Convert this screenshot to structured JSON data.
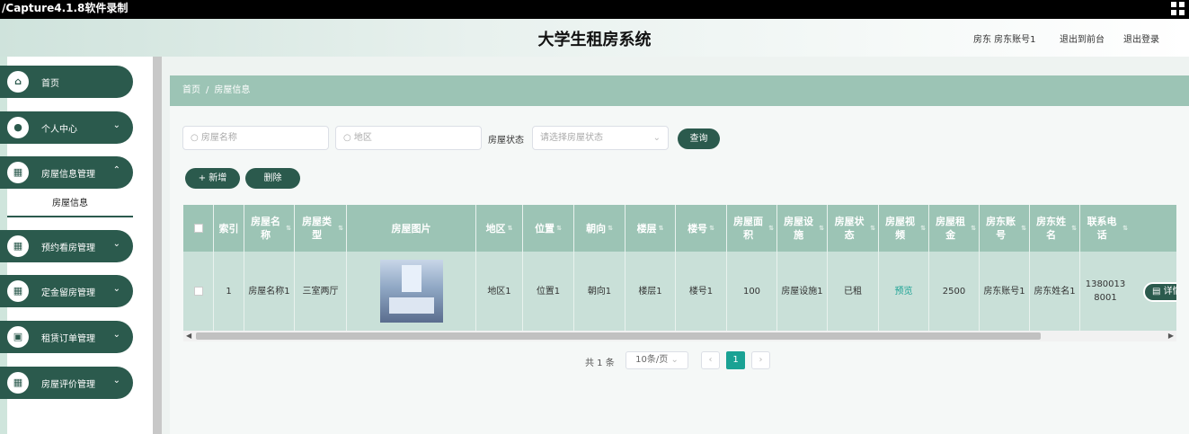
{
  "capture": {
    "title": "/Capture4.1.8软件录制"
  },
  "header": {
    "title": "大学生租房系统",
    "user_text": "房东 房东账号1",
    "back_home": "退出到前台",
    "logout": "退出登录"
  },
  "sidebar": {
    "items": [
      {
        "label": "首页",
        "icon": "home-icon"
      },
      {
        "label": "个人中心",
        "icon": "user-icon"
      },
      {
        "label": "房屋信息管理",
        "icon": "grid-icon"
      },
      {
        "label": "预约看房管理",
        "icon": "grid-icon"
      },
      {
        "label": "定金留房管理",
        "icon": "grid-icon"
      },
      {
        "label": "租赁订单管理",
        "icon": "image-icon"
      },
      {
        "label": "房屋评价管理",
        "icon": "grid-icon"
      }
    ],
    "submenu_label": "房屋信息"
  },
  "breadcrumb": {
    "home": "首页",
    "sep": "/",
    "current": "房屋信息"
  },
  "search": {
    "house_name_placeholder": "房屋名称",
    "area_placeholder": "地区",
    "status_label": "房屋状态",
    "status_placeholder": "请选择房屋状态",
    "query_button": "查询"
  },
  "actions": {
    "add": "+ 新增",
    "delete": "删除"
  },
  "table": {
    "headers": [
      "索引",
      "房屋名称",
      "房屋类型",
      "房屋图片",
      "地区",
      "位置",
      "朝向",
      "楼层",
      "楼号",
      "房屋面积",
      "房屋设施",
      "房屋状态",
      "房屋视频",
      "房屋租金",
      "房东账号",
      "房东姓名",
      "联系电话"
    ],
    "row": {
      "index": "1",
      "house_name": "房屋名称1",
      "house_type": "三室两厅",
      "area": "地区1",
      "location": "位置1",
      "orientation": "朝向1",
      "floor": "楼层1",
      "building": "楼号1",
      "size": "100",
      "facilities": "房屋设施1",
      "status": "已租",
      "video": "预览",
      "rent": "2500",
      "landlord_account": "房东账号1",
      "landlord_name": "房东姓名1",
      "phone": "13800138001",
      "detail_button": "详情"
    }
  },
  "pagination": {
    "total": "共 1 条",
    "page_size": "10条/页",
    "prev": "‹",
    "current": "1",
    "next": "›"
  }
}
